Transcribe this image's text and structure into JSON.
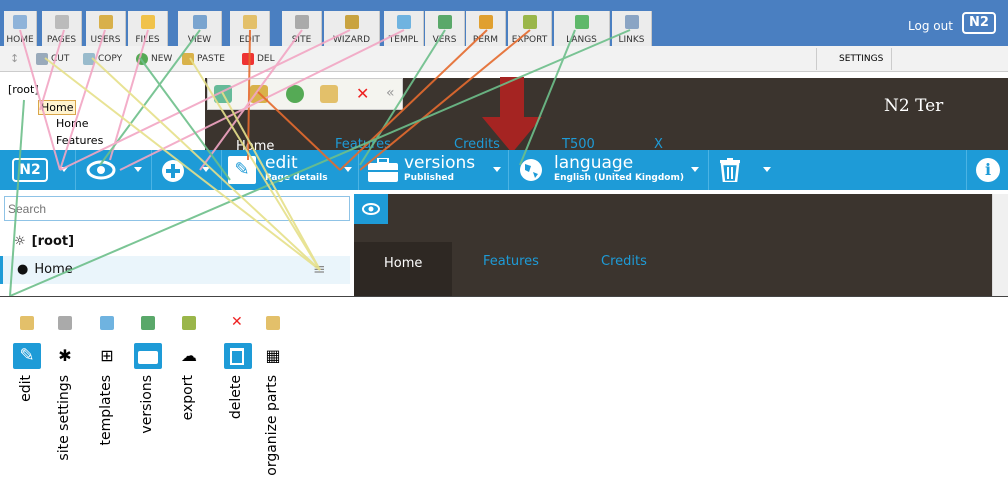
{
  "old_toolbar": {
    "buttons": [
      {
        "label": "HOME",
        "icon": "home-icon"
      },
      {
        "label": "PAGES",
        "icon": "pages-icon"
      },
      {
        "label": "USERS",
        "icon": "users-icon"
      },
      {
        "label": "FILES",
        "icon": "folder-icon"
      },
      {
        "label": "VIEW",
        "icon": "eye-icon"
      },
      {
        "label": "EDIT",
        "icon": "edit-icon"
      },
      {
        "label": "SITE",
        "icon": "site-settings-icon"
      },
      {
        "label": "WIZARD",
        "icon": "wand-icon"
      },
      {
        "label": "TEMPL",
        "icon": "template-icon"
      },
      {
        "label": "VERS",
        "icon": "versions-icon"
      },
      {
        "label": "PERM",
        "icon": "key-icon"
      },
      {
        "label": "EXPORT",
        "icon": "export-icon"
      },
      {
        "label": "LANGS",
        "icon": "globe-icon"
      },
      {
        "label": "LINKS",
        "icon": "links-icon"
      }
    ],
    "logout": "Log out",
    "logo": "N2"
  },
  "old_subbar": {
    "buttons": [
      {
        "label": "CUT",
        "icon": "scissors-icon"
      },
      {
        "label": "COPY",
        "icon": "copy-icon"
      },
      {
        "label": "NEW",
        "icon": "plus-icon"
      },
      {
        "label": "PASTE",
        "icon": "paste-icon"
      },
      {
        "label": "DEL",
        "icon": "delete-icon"
      }
    ],
    "settings": "SETTINGS"
  },
  "old_tree": {
    "root": "[root]",
    "home": "Home",
    "child1": "Home",
    "child2": "Features"
  },
  "old_page": {
    "brand": "N2 Ter",
    "nav": [
      "Home",
      "Features",
      "Credits",
      "T500",
      "X"
    ]
  },
  "navbar": {
    "logo": "N2",
    "edit_title": "edit",
    "edit_sub": "Page details",
    "versions_title": "versions",
    "versions_sub": "Published",
    "language_title": "language",
    "language_sub": "English (United Kingdom)",
    "colors": {
      "bar": "#1e9bd7"
    }
  },
  "tree": {
    "search_placeholder": "Search",
    "root": "[root]",
    "home": "Home"
  },
  "frame": {
    "nav": [
      "Home",
      "Features",
      "Credits"
    ]
  },
  "legend": [
    {
      "label": "edit",
      "icon": "edit-icon"
    },
    {
      "label": "site settings",
      "icon": "gear-icon"
    },
    {
      "label": "templates",
      "icon": "template-icon"
    },
    {
      "label": "versions",
      "icon": "briefcase-icon"
    },
    {
      "label": "export",
      "icon": "cloud-download-icon"
    },
    {
      "label": "delete",
      "icon": "trash-icon"
    },
    {
      "label": "organize parts",
      "icon": "grid-icon"
    }
  ]
}
